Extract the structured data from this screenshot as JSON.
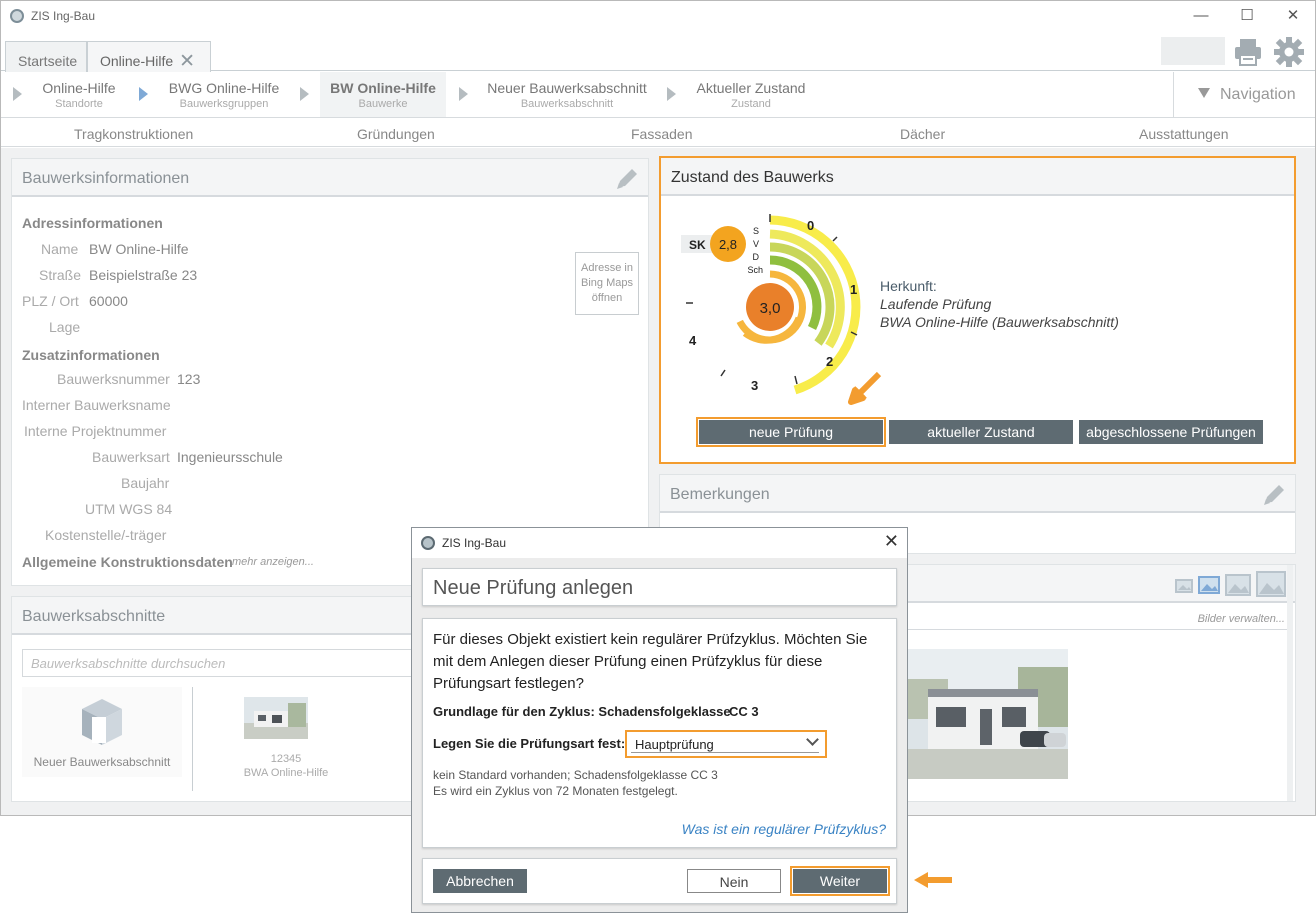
{
  "app": {
    "title": "ZIS Ing-Bau",
    "tabs": [
      {
        "label": "Startseite"
      },
      {
        "label": "Online-Hilfe",
        "close": "✕"
      }
    ],
    "nav_label": "Navigation"
  },
  "breadcrumb": [
    {
      "title": "Online-Hilfe",
      "sub": "Standorte"
    },
    {
      "title": "BWG Online-Hilfe",
      "sub": "Bauwerksgruppen"
    },
    {
      "title": "BW Online-Hilfe",
      "sub": "Bauwerke"
    },
    {
      "title": "Neuer Bauwerksabschnitt",
      "sub": "Bauwerksabschnitt"
    },
    {
      "title": "Aktueller Zustand",
      "sub": "Zustand"
    }
  ],
  "categories": [
    "Tragkonstruktionen",
    "Gründungen",
    "Fassaden",
    "Dächer",
    "Ausstattungen"
  ],
  "info_panel": {
    "title": "Bauwerksinformationen",
    "address_heading": "Adressinformationen",
    "name_label": "Name",
    "name_value": "BW Online-Hilfe",
    "street_label": "Straße",
    "street_value": "Beispielstraße 23",
    "zip_label": "PLZ / Ort",
    "zip_value": "60000",
    "lage_label": "Lage",
    "bing_button": "Adresse in Bing Maps öffnen",
    "extra_heading": "Zusatzinformationen",
    "bwnr_label": "Bauwerksnummer",
    "bwnr_value": "123",
    "intname_label": "Interner Bauwerksname",
    "projnr_label": "Interne Projektnummer",
    "art_label": "Bauwerksart",
    "art_value": "Ingenieursschule",
    "baujahr_label": "Baujahr",
    "utm_label": "UTM WGS 84",
    "kosten_label": "Kostenstelle/-träger",
    "general_heading": "Allgemeine Konstruktionsdaten",
    "more_link": "mehr anzeigen..."
  },
  "sections_panel": {
    "title": "Bauwerksabschnitte",
    "search_placeholder": "Bauwerksabschnitte durchsuchen",
    "new_label": "Neuer Bauwerksabschnitt",
    "item_number": "12345",
    "item_name": "BWA Online-Hilfe"
  },
  "zustand_panel": {
    "title": "Zustand des Bauwerks",
    "sk_label": "SK",
    "sk_value": "2,8",
    "center_value": "3,0",
    "ring_labels": [
      "S",
      "V",
      "D",
      "Sch"
    ],
    "scale_labels": [
      "0",
      "1",
      "2",
      "3",
      "4"
    ],
    "herkunft_label": "Herkunft:",
    "herkunft_line1": "Laufende Prüfung",
    "herkunft_line2": "BWA Online-Hilfe (Bauwerksabschnitt)",
    "buttons": [
      "neue Prüfung",
      "aktueller Zustand",
      "abgeschlossene Prüfungen"
    ],
    "colors": {
      "yellow": "#f8ec4a",
      "lightgreen": "#c8d65a",
      "green": "#8fbf3f",
      "orange": "#f6b63d",
      "center": "#e9802a",
      "sk": "#f3a41f"
    }
  },
  "bemerkungen_panel": {
    "title": "Bemerkungen"
  },
  "images_panel": {
    "manage_link": "Bilder verwalten..."
  },
  "dialog": {
    "window_title": "ZIS Ing-Bau",
    "heading": "Neue Prüfung anlegen",
    "question": "Für dieses Objekt existiert kein regulärer Prüfzyklus. Möchten Sie mit dem Anlegen dieser Prüfung einen Prüfzyklus für diese Prüfungsart festlegen?",
    "basis_label": "Grundlage für den Zyklus: Schadensfolgeklasse",
    "basis_value": "CC 3",
    "type_label": "Legen Sie die Prüfungsart fest:",
    "type_value": "Hauptprüfung",
    "note1": "kein Standard vorhanden; Schadensfolgeklasse CC 3",
    "note2": "Es wird ein Zyklus von 72 Monaten festgelegt.",
    "help_link": "Was ist ein regulärer Prüfzyklus?",
    "cancel": "Abbrechen",
    "no": "Nein",
    "next": "Weiter"
  },
  "accent_color": "#f39c2f"
}
